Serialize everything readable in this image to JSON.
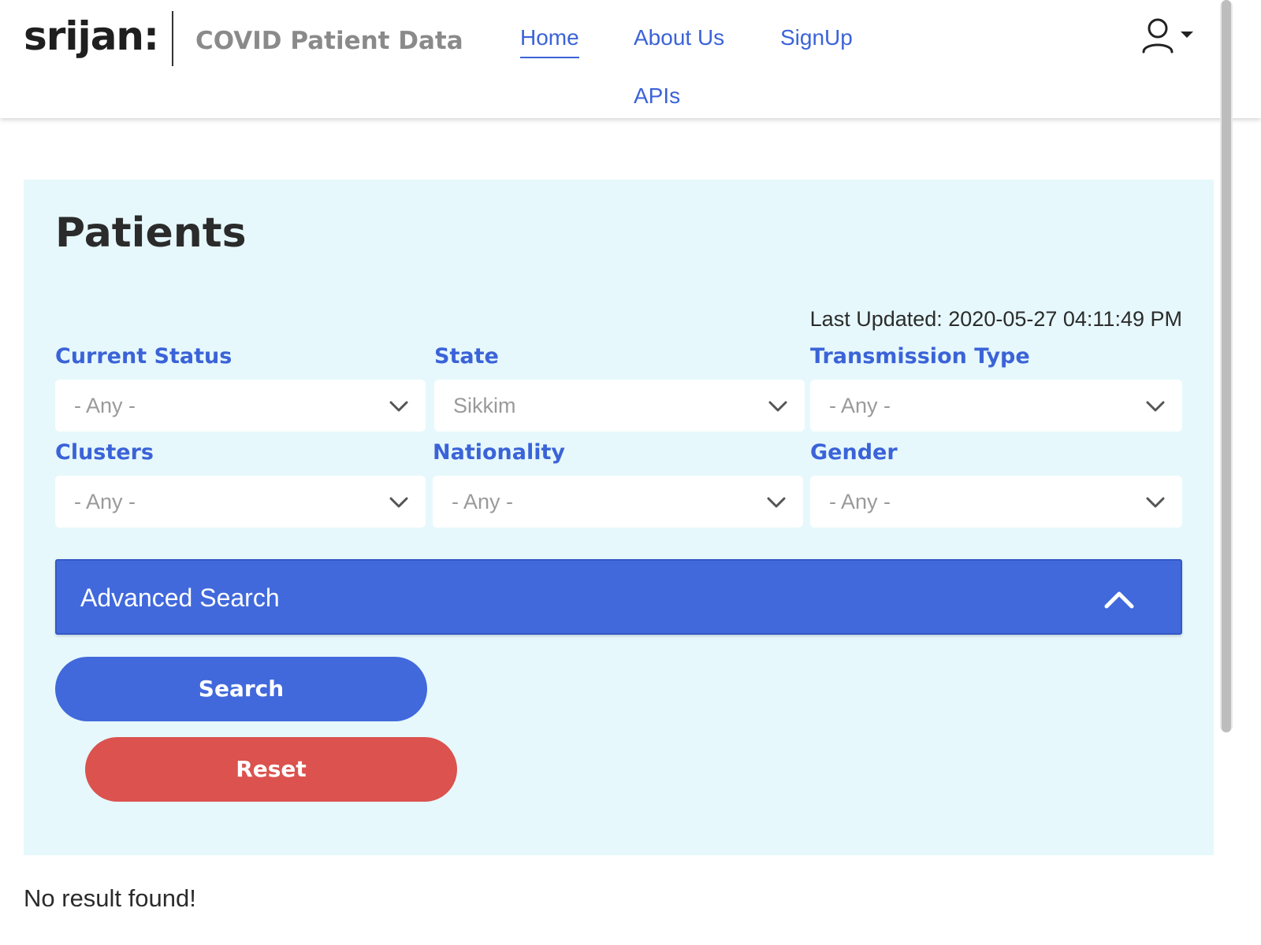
{
  "header": {
    "logo": "srijan:",
    "site_name": "COVID Patient Data",
    "nav": {
      "home": "Home",
      "about": "About Us",
      "signup": "SignUp",
      "apis": "APIs"
    },
    "user_icon": "user-icon"
  },
  "main": {
    "title": "Patients",
    "last_updated": "Last Updated: 2020-05-27 04:11:49 PM",
    "filters": {
      "current_status": {
        "label": "Current Status",
        "value": "- Any -"
      },
      "state": {
        "label": "State",
        "value": "Sikkim"
      },
      "transmission_type": {
        "label": "Transmission Type",
        "value": "- Any -"
      },
      "clusters": {
        "label": "Clusters",
        "value": "- Any -"
      },
      "nationality": {
        "label": "Nationality",
        "value": "- Any -"
      },
      "gender": {
        "label": "Gender",
        "value": "- Any -"
      }
    },
    "advanced_search": "Advanced Search",
    "search_button": "Search",
    "reset_button": "Reset"
  },
  "result_message": "No result found!",
  "colors": {
    "accent": "#3b63d8",
    "panel_bg": "#e6f8fc",
    "reset": "#db524e"
  }
}
